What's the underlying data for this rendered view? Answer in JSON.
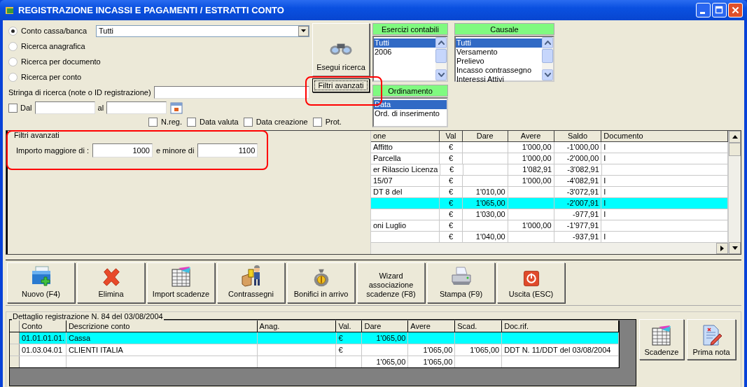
{
  "window": {
    "title": "REGISTRAZIONE INCASSI E PAGAMENTI / ESTRATTI CONTO"
  },
  "search_modes": [
    {
      "label": "Conto cassa/banca",
      "selected": true
    },
    {
      "label": "Ricerca anagrafica",
      "selected": false
    },
    {
      "label": "Ricerca per documento",
      "selected": false
    },
    {
      "label": "Ricerca per conto",
      "selected": false
    }
  ],
  "account_combo": {
    "value": "Tutti"
  },
  "search_string": {
    "label": "Stringa di ricerca (note o ID registrazione)"
  },
  "date_range": {
    "checked": false,
    "from_label": "Dal",
    "to_label": "al"
  },
  "search_options": [
    {
      "label": "N.reg.",
      "checked": false
    },
    {
      "label": "Data valuta",
      "checked": false
    },
    {
      "label": "Data creazione",
      "checked": false
    },
    {
      "label": "Prot.",
      "checked": false
    }
  ],
  "search_button": {
    "label": "Esegui ricerca"
  },
  "advanced_button": {
    "label": "Filtri avanzati"
  },
  "fiscal_years": {
    "title": "Esercizi contabili",
    "items": [
      {
        "label": "Tutti",
        "selected": true
      },
      {
        "label": "2006",
        "selected": false
      }
    ]
  },
  "ordering": {
    "title": "Ordinamento",
    "items": [
      {
        "label": "Data",
        "selected": true
      },
      {
        "label": "Ord. di inserimento",
        "selected": false
      }
    ]
  },
  "causale": {
    "title": "Causale",
    "items": [
      {
        "label": "Tutti",
        "selected": true
      },
      {
        "label": "Versamento",
        "selected": false
      },
      {
        "label": "Prelievo",
        "selected": false
      },
      {
        "label": "Incasso contrassegno",
        "selected": false
      },
      {
        "label": "Interessi Attivi",
        "selected": false
      }
    ]
  },
  "advanced_filters": {
    "title": "Filtri avanzati",
    "min_label": "Importo maggiore di :",
    "min_value": "1000",
    "max_label": "e minore di",
    "max_value": "1100"
  },
  "movements": {
    "columns": [
      "one",
      "Val",
      "Dare",
      "Avere",
      "Saldo",
      "Documento"
    ],
    "rows": [
      {
        "selected": false,
        "cells": [
          "Affitto",
          "€",
          null,
          "1'000,00",
          "-1'000,00",
          "I"
        ]
      },
      {
        "selected": false,
        "cells": [
          "Parcella",
          "€",
          null,
          "1'000,00",
          "-2'000,00",
          "I"
        ]
      },
      {
        "selected": false,
        "cells": [
          "er Rilascio Licenza",
          "€",
          null,
          "1'082,91",
          "-3'082,91",
          null
        ]
      },
      {
        "selected": false,
        "cells": [
          "15/07",
          "€",
          null,
          "1'000,00",
          "-4'082,91",
          "I"
        ]
      },
      {
        "selected": false,
        "cells": [
          "DT 8 del",
          "€",
          "1'010,00",
          null,
          "-3'072,91",
          "I"
        ]
      },
      {
        "selected": true,
        "cells": [
          null,
          "€",
          "1'065,00",
          null,
          "-2'007,91",
          "I"
        ]
      },
      {
        "selected": false,
        "cells": [
          null,
          "€",
          "1'030,00",
          null,
          "-977,91",
          "I"
        ]
      },
      {
        "selected": false,
        "cells": [
          "oni Luglio",
          "€",
          null,
          "1'000,00",
          "-1'977,91",
          null
        ]
      },
      {
        "selected": false,
        "cells": [
          null,
          "€",
          "1'040,00",
          null,
          "-937,91",
          "I"
        ]
      }
    ]
  },
  "toolbar": [
    "Nuovo (F4)",
    "Elimina",
    "Import scadenze",
    "Contrassegni",
    "Bonifici in arrivo",
    "Wizard associazione scadenze (F8)",
    "Stampa (F9)",
    "Uscita (ESC)"
  ],
  "detail": {
    "title": "Dettaglio registrazione N. 84 del 03/08/2004",
    "columns": [
      "Conto",
      "Descrizione conto",
      "Anag.",
      "Val.",
      "Dare",
      "Avere",
      "Scad.",
      "Doc.rif."
    ],
    "rows": [
      {
        "selected": true,
        "cells": [
          "01.01.01.01.",
          "Cassa",
          null,
          "€",
          "1'065,00",
          null,
          null,
          null
        ]
      },
      {
        "selected": false,
        "cells": [
          "01.03.04.01",
          "CLIENTI ITALIA",
          null,
          "€",
          null,
          "1'065,00",
          "1'065,00",
          "DDT N. 11/DDT del 03/08/2004"
        ]
      },
      {
        "selected": false,
        "cells": [
          null,
          null,
          null,
          null,
          "1'065,00",
          "1'065,00",
          null,
          null
        ]
      }
    ]
  },
  "side_buttons": [
    "Scadenze",
    "Prima nota"
  ]
}
